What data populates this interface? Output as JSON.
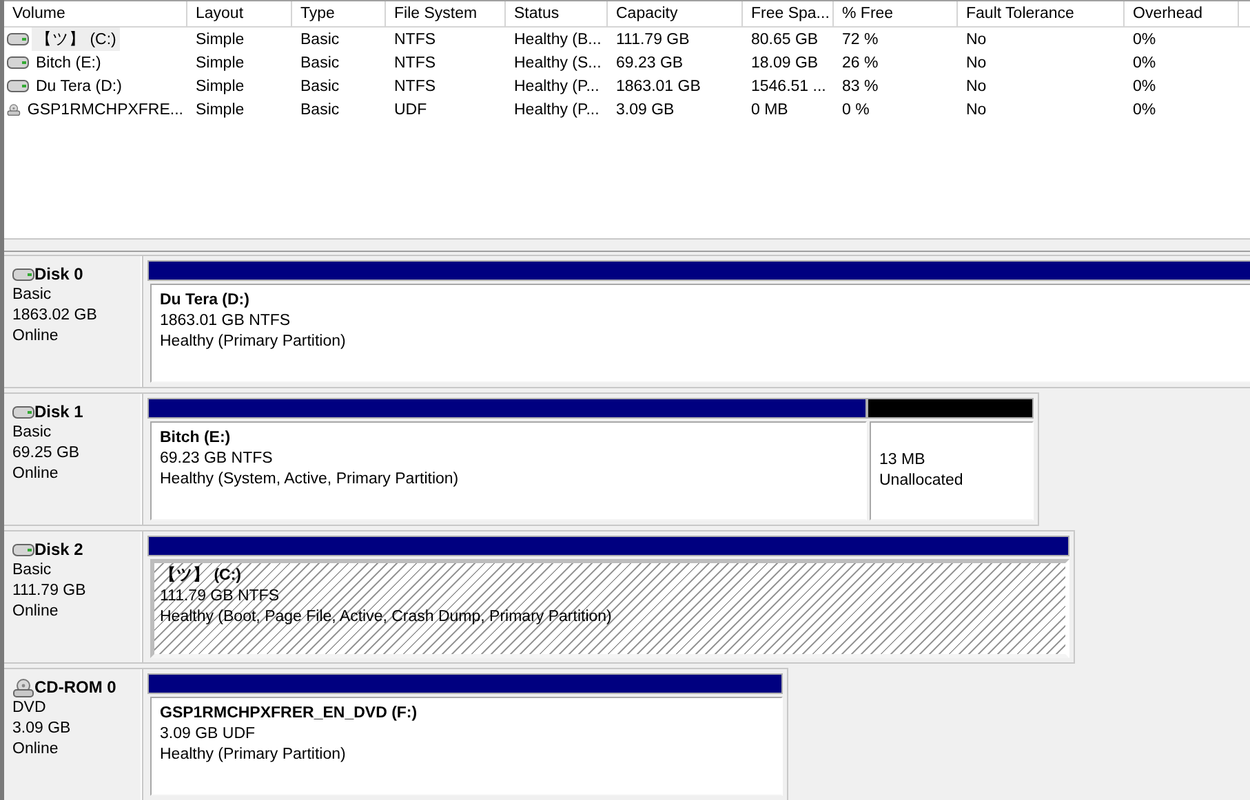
{
  "volumes": {
    "columns": [
      "Volume",
      "Layout",
      "Type",
      "File System",
      "Status",
      "Capacity",
      "Free Spa...",
      "% Free",
      "Fault Tolerance",
      "Overhead"
    ],
    "rows": [
      {
        "kind": "disk",
        "selected": true,
        "cells": [
          "【ツ】 (C:)",
          "Simple",
          "Basic",
          "NTFS",
          "Healthy (B...",
          "111.79 GB",
          "80.65 GB",
          "72 %",
          "No",
          "0%"
        ]
      },
      {
        "kind": "disk",
        "selected": false,
        "cells": [
          "Bitch (E:)",
          "Simple",
          "Basic",
          "NTFS",
          "Healthy (S...",
          "69.23 GB",
          "18.09 GB",
          "26 %",
          "No",
          "0%"
        ]
      },
      {
        "kind": "disk",
        "selected": false,
        "cells": [
          "Du Tera (D:)",
          "Simple",
          "Basic",
          "NTFS",
          "Healthy (P...",
          "1863.01 GB",
          "1546.51 ...",
          "83 %",
          "No",
          "0%"
        ]
      },
      {
        "kind": "cdrom",
        "selected": false,
        "cells": [
          "GSP1RMCHPXFRE...",
          "Simple",
          "Basic",
          "UDF",
          "Healthy (P...",
          "3.09 GB",
          "0 MB",
          "0 %",
          "No",
          "0%"
        ]
      }
    ]
  },
  "disks": [
    {
      "kind": "disk",
      "name": "Disk 0",
      "type": "Basic",
      "size": "1863.02 GB",
      "status": "Online",
      "partitions": [
        {
          "kind": "primary",
          "selected": false,
          "name": "Du Tera  (D:)",
          "size": "1863.01 GB NTFS",
          "status": "Healthy (Primary Partition)"
        }
      ]
    },
    {
      "kind": "disk",
      "name": "Disk 1",
      "type": "Basic",
      "size": "69.25 GB",
      "status": "Online",
      "partitions": [
        {
          "kind": "primary",
          "selected": false,
          "name": "Bitch  (E:)",
          "size": "69.23 GB NTFS",
          "status": "Healthy (System, Active, Primary Partition)"
        },
        {
          "kind": "unallocated",
          "selected": false,
          "size": "13 MB",
          "status": "Unallocated"
        }
      ]
    },
    {
      "kind": "disk",
      "name": "Disk 2",
      "type": "Basic",
      "size": "111.79 GB",
      "status": "Online",
      "partitions": [
        {
          "kind": "primary",
          "selected": true,
          "name": "【ツ】  (C:)",
          "size": "111.79 GB NTFS",
          "status": "Healthy (Boot, Page File, Active, Crash Dump, Primary Partition)"
        }
      ]
    },
    {
      "kind": "cdrom",
      "name": "CD-ROM 0",
      "type": "DVD",
      "size": "3.09 GB",
      "status": "Online",
      "partitions": [
        {
          "kind": "primary",
          "selected": false,
          "name": "GSP1RMCHPXFRER_EN_DVD  (F:)",
          "size": "3.09 GB UDF",
          "status": "Healthy (Primary Partition)"
        }
      ]
    }
  ]
}
